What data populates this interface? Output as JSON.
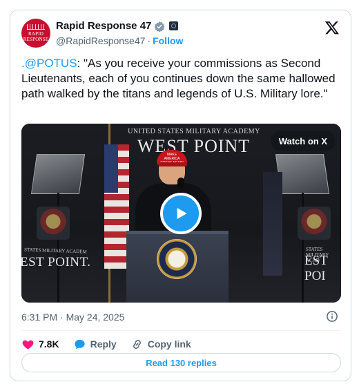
{
  "author": {
    "display_name": "Rapid Response 47",
    "handle": "@RapidResponse47",
    "separator": "·",
    "follow_label": "Follow",
    "avatar_text_line1": "RAPID",
    "avatar_text_line2": "RESPONSE"
  },
  "tweet": {
    "mention": ".@POTUS",
    "text": ": \"As you receive your commissions as Second Lieutenants, each of you continues down the same hallowed path walked by the titans and legends of U.S. Military lore.\""
  },
  "media": {
    "watch_label": "Watch on X",
    "banner_top": "UNITED STATES MILITARY ACADEMY",
    "banner_main": "WEST POINT",
    "banner_left_top": "STATES MILITARY ACADEM",
    "banner_left": "EST POINT.",
    "banner_right_top": "STATES MILITARY ACAD",
    "banner_right": "EST POI",
    "cap_text": "MAKE AMERICA GREAT AGAIN"
  },
  "meta": {
    "timestamp": "6:31 PM · May 24, 2025"
  },
  "actions": {
    "like_count": "7.8K",
    "reply_label": "Reply",
    "copy_label": "Copy link"
  },
  "footer": {
    "read_replies": "Read 130 replies"
  },
  "colors": {
    "accent": "#1d9bf0",
    "like": "#f91880",
    "avatar": "#c8102e",
    "text_primary": "#0f1419",
    "text_secondary": "#536471"
  }
}
